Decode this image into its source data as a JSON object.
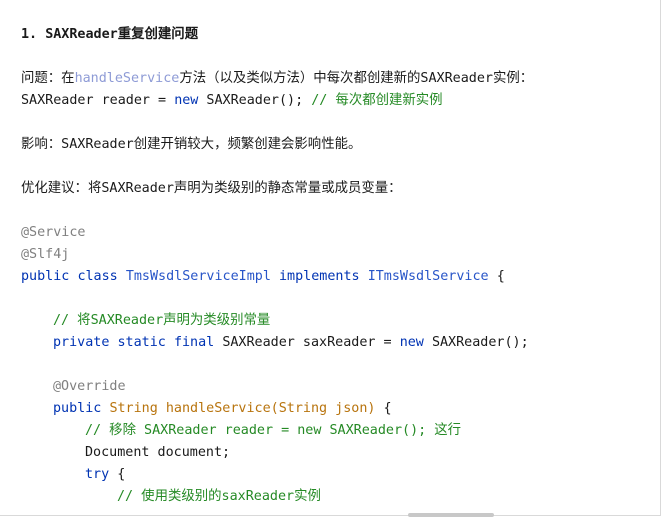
{
  "heading": {
    "number": "1. ",
    "title": "SAXReader重复创建问题"
  },
  "problem": {
    "label": "问题：",
    "prefix": "在",
    "method_ref": "handleService",
    "suffix": "方法（以及类似方法）中每次都创建新的SAXReader实例："
  },
  "snippet": {
    "code_plain_1": "SAXReader reader = ",
    "code_new": "new",
    "code_plain_2": " SAXReader(); ",
    "code_comment": "// 每次都创建新实例"
  },
  "impact": {
    "text": "影响：SAXReader创建开销较大，频繁创建会影响性能。"
  },
  "suggestion": {
    "text": "优化建议：将SAXReader声明为类级别的静态常量或成员变量："
  },
  "code": {
    "anno_service": "@Service",
    "anno_slf4j": "@Slf4j",
    "kw_public": "public",
    "kw_class": "class",
    "class_name": "TmsWsdlServiceImpl",
    "kw_implements": "implements",
    "interface_name": "ITmsWsdlService",
    "open_brace": "{",
    "comment_declare": "// 将SAXReader声明为类级别常量",
    "kw_private": "private",
    "kw_static": "static",
    "kw_final": "final",
    "field_decl": "SAXReader saxReader = ",
    "kw_new": "new",
    "field_init": "SAXReader();",
    "anno_override": "@Override",
    "method_public": "public",
    "method_sig": "String handleService(String json)",
    "method_brace": " {",
    "comment_remove": "// 移除 SAXReader reader = new SAXReader(); 这行",
    "doc_decl": "Document document;",
    "kw_try": "try",
    "try_brace": " {",
    "comment_use": "// 使用类级别的saxReader实例"
  }
}
